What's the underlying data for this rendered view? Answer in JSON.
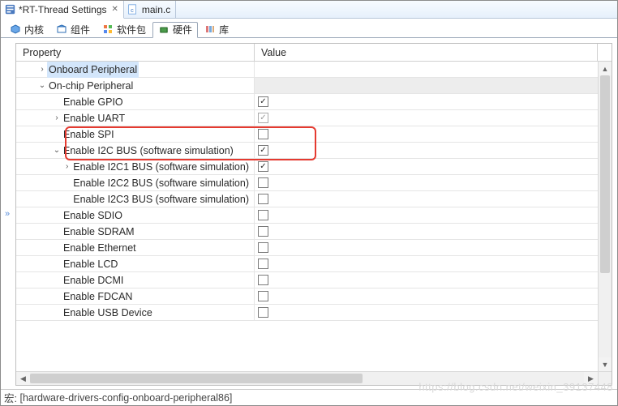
{
  "tabs": {
    "active": {
      "label": "*RT-Thread Settings",
      "icon": "settings-icon"
    },
    "inactive": {
      "label": "main.c",
      "icon": "c-file-icon"
    }
  },
  "subtabs": {
    "kernel": "内核",
    "components": "组件",
    "packages": "软件包",
    "hardware": "硬件",
    "library": "库"
  },
  "columns": {
    "property": "Property",
    "value": "Value"
  },
  "tree": [
    {
      "indent": 1,
      "twisty": ">",
      "label": "Onboard Peripheral",
      "value": null,
      "sel": "on",
      "gray": false,
      "name": "item-onboard-peripheral"
    },
    {
      "indent": 1,
      "twisty": "v",
      "label": "On-chip Peripheral",
      "value": null,
      "sel": null,
      "gray": true,
      "name": "item-onchip-peripheral"
    },
    {
      "indent": 2,
      "twisty": "",
      "label": "Enable GPIO",
      "value": "on",
      "name": "item-enable-gpio"
    },
    {
      "indent": 2,
      "twisty": ">",
      "label": "Enable UART",
      "value": "on-gray",
      "name": "item-enable-uart"
    },
    {
      "indent": 2,
      "twisty": "",
      "label": "Enable SPI",
      "value": "off",
      "name": "item-enable-spi"
    },
    {
      "indent": 2,
      "twisty": "v",
      "label": "Enable I2C BUS (software simulation)",
      "value": "on",
      "name": "item-enable-i2c-bus"
    },
    {
      "indent": 3,
      "twisty": ">",
      "label": "Enable I2C1 BUS (software simulation)",
      "value": "on",
      "name": "item-enable-i2c1-bus"
    },
    {
      "indent": 3,
      "twisty": "",
      "label": "Enable I2C2 BUS (software simulation)",
      "value": "off",
      "name": "item-enable-i2c2-bus"
    },
    {
      "indent": 3,
      "twisty": "",
      "label": "Enable I2C3 BUS (software simulation)",
      "value": "off",
      "name": "item-enable-i2c3-bus"
    },
    {
      "indent": 2,
      "twisty": "",
      "label": "Enable SDIO",
      "value": "off",
      "name": "item-enable-sdio"
    },
    {
      "indent": 2,
      "twisty": "",
      "label": "Enable SDRAM",
      "value": "off",
      "name": "item-enable-sdram"
    },
    {
      "indent": 2,
      "twisty": "",
      "label": "Enable Ethernet",
      "value": "off",
      "name": "item-enable-ethernet"
    },
    {
      "indent": 2,
      "twisty": "",
      "label": "Enable LCD",
      "value": "off",
      "name": "item-enable-lcd"
    },
    {
      "indent": 2,
      "twisty": "",
      "label": "Enable DCMI",
      "value": "off",
      "name": "item-enable-dcmi"
    },
    {
      "indent": 2,
      "twisty": "",
      "label": "Enable FDCAN",
      "value": "off",
      "name": "item-enable-fdcan"
    },
    {
      "indent": 2,
      "twisty": "",
      "label": "Enable USB Device",
      "value": "off",
      "name": "item-enable-usb-device"
    }
  ],
  "footer": {
    "label": "宏:",
    "value": "[hardware-drivers-config-onboard-peripheral86]"
  },
  "watermark": "https://blog.csdn.net/weixin_39137448"
}
